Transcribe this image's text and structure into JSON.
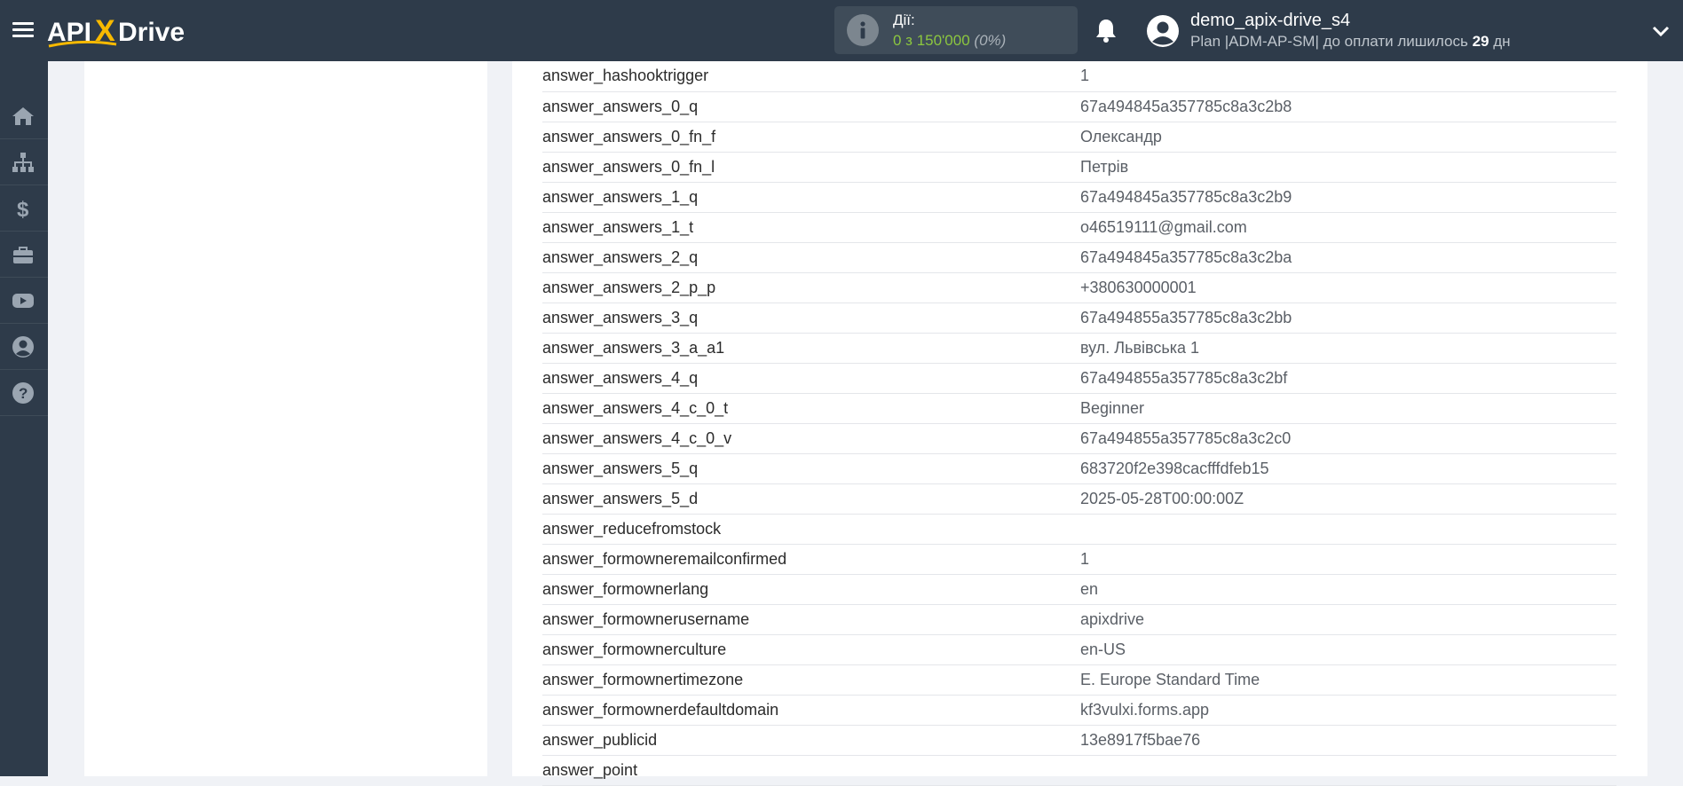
{
  "header": {
    "logo_text": "APIXDrive",
    "actions_label": "Дії:",
    "actions_count": "0 з 150'000",
    "actions_percent": "(0%)",
    "username": "demo_apix-drive_s4",
    "plan_prefix": "Plan |ADM-AP-SM| до оплати лишилось",
    "plan_days": "29",
    "plan_suffix": "дн"
  },
  "sidebar": {
    "items": [
      {
        "icon": "home-icon"
      },
      {
        "icon": "sitemap-icon"
      },
      {
        "icon": "dollar-icon"
      },
      {
        "icon": "briefcase-icon"
      },
      {
        "icon": "youtube-icon"
      },
      {
        "icon": "user-circle-icon"
      },
      {
        "icon": "help-icon"
      }
    ]
  },
  "colors": {
    "header_bg": "#2e3b4a",
    "accent_green": "#8cc63f",
    "logo_x": "#f7b900"
  },
  "table": {
    "rows": [
      {
        "key": "answer_hashooktrigger",
        "value": "1"
      },
      {
        "key": "answer_answers_0_q",
        "value": "67a494845a357785c8a3c2b8"
      },
      {
        "key": "answer_answers_0_fn_f",
        "value": "Олександр"
      },
      {
        "key": "answer_answers_0_fn_l",
        "value": "Петрів"
      },
      {
        "key": "answer_answers_1_q",
        "value": "67a494845a357785c8a3c2b9"
      },
      {
        "key": "answer_answers_1_t",
        "value": "o46519111@gmail.com"
      },
      {
        "key": "answer_answers_2_q",
        "value": "67a494845a357785c8a3c2ba"
      },
      {
        "key": "answer_answers_2_p_p",
        "value": "+380630000001"
      },
      {
        "key": "answer_answers_3_q",
        "value": "67a494855a357785c8a3c2bb"
      },
      {
        "key": "answer_answers_3_a_a1",
        "value": "вул. Львівська 1"
      },
      {
        "key": "answer_answers_4_q",
        "value": "67a494855a357785c8a3c2bf"
      },
      {
        "key": "answer_answers_4_c_0_t",
        "value": "Beginner"
      },
      {
        "key": "answer_answers_4_c_0_v",
        "value": "67a494855a357785c8a3c2c0"
      },
      {
        "key": "answer_answers_5_q",
        "value": "683720f2e398cacfffdfeb15"
      },
      {
        "key": "answer_answers_5_d",
        "value": "2025-05-28T00:00:00Z"
      },
      {
        "key": "answer_reducefromstock",
        "value": ""
      },
      {
        "key": "answer_formowneremailconfirmed",
        "value": "1"
      },
      {
        "key": "answer_formownerlang",
        "value": "en"
      },
      {
        "key": "answer_formownerusername",
        "value": "apixdrive"
      },
      {
        "key": "answer_formownerculture",
        "value": "en-US"
      },
      {
        "key": "answer_formownertimezone",
        "value": "E. Europe Standard Time"
      },
      {
        "key": "answer_formownerdefaultdomain",
        "value": "kf3vulxi.forms.app"
      },
      {
        "key": "answer_publicid",
        "value": "13e8917f5bae76"
      },
      {
        "key": "answer_point",
        "value": ""
      }
    ]
  }
}
